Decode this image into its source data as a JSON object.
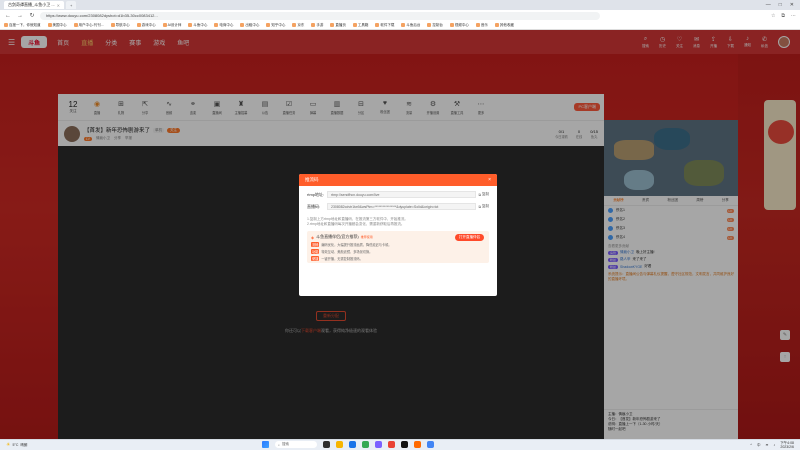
{
  "browser": {
    "tabs": [
      {
        "label": "古剑奇谭直播_斗鱼小卫 ...",
        "active": true
      },
      {
        "label": "+",
        "active": false
      }
    ],
    "url": "https://www.douyu.com/2308082dyshot=d1b35-30cc0083412...",
    "bookmarks": [
      "百度一下，你就知道",
      "美国中心",
      "用户中心-刊刊...",
      "导航中心",
      "游戏中心",
      "AI设计师",
      "斗鱼中心",
      "电商中心",
      "出租中心",
      "知乎中心",
      "京东",
      "手游",
      "直播页",
      "工具箱",
      "软件下载",
      "斗鱼后台",
      "控制台",
      "视频中心",
      "音乐",
      "其他收藏"
    ],
    "window_controls": [
      "—",
      "□",
      "✕"
    ]
  },
  "site": {
    "logo": "斗鱼",
    "nav": [
      "首页",
      "直播",
      "分类",
      "赛事",
      "游戏",
      "鱼吧"
    ],
    "nav_active_index": 1,
    "header_right": [
      {
        "icon": "search-icon",
        "label": "搜索"
      },
      {
        "icon": "history-icon",
        "label": "历史"
      },
      {
        "icon": "follow-icon",
        "label": "关注"
      },
      {
        "icon": "message-icon",
        "label": "消息"
      },
      {
        "icon": "upload-icon",
        "label": "开播"
      },
      {
        "icon": "download-icon",
        "label": "下载"
      },
      {
        "icon": "bell-icon",
        "label": "通知"
      },
      {
        "icon": "mail-icon",
        "label": "私信"
      }
    ]
  },
  "funcbar": {
    "count_value": "12",
    "count_label": "关注",
    "items": [
      "直播",
      "礼物",
      "分享",
      "音频",
      "连麦",
      "直播间",
      "主播招募",
      "公告",
      "直播任务",
      "弹幕",
      "直播数据",
      "分区",
      "粉丝团",
      "流量",
      "开播设置",
      "直播工具",
      "更多"
    ],
    "pc_button": "PC客户端"
  },
  "room": {
    "title": "【首发】新年恐怖剧游来了",
    "category_tag": "单机",
    "follow": "关注",
    "level": "LV",
    "streamer": "情痕小卫",
    "meta": [
      "分享",
      "举报"
    ],
    "stats": [
      {
        "value": "0/1",
        "label": "今日观看"
      },
      {
        "value": "0",
        "label": "在线"
      },
      {
        "value": "0/15",
        "label": "鱼丸"
      }
    ]
  },
  "video": {
    "closed_button": "重新分配",
    "note_prefix": "你还可以",
    "note_link": "下载客户端",
    "note_suffix": "观看，获得纯净极速的观看体验"
  },
  "modal": {
    "title": "推流码",
    "close": "×",
    "rows": [
      {
        "label": "rtmp地址:",
        "value": "rtmp://sendfhcn.douyu.com/live",
        "copy": "复制"
      },
      {
        "label": "直播码:",
        "value": "2308082cdvtr1tw9&wsPtm=****************&dyuplate=Solid&origin=tct",
        "copy": "复制"
      }
    ],
    "tips": [
      "1.复制上方rtmp地址和直播码，在推流第三方软件中，开始推流。",
      "2.rtmp地址和直播码每次开播都会变化，需重新获取后再推流。"
    ],
    "promo": {
      "title": "斗鱼直播伴侣(官方推荐)",
      "subtitle": "推荐使用",
      "button": "打开直播伴侣",
      "lines": [
        {
          "key": "流畅",
          "text": "编码优化，大幅提升推流画质，降低延迟与卡顿。"
        },
        {
          "key": "功能",
          "text": "特效互动、美颜滤镜、多场景切换。"
        },
        {
          "key": "便捷",
          "text": "一键开播，无需复制推流码。"
        }
      ]
    }
  },
  "chat": {
    "tabs": [
      "贡献榜",
      "贵宾",
      "粉丝团",
      "周榜",
      "分享"
    ],
    "active_tab_index": 0,
    "ranks": [
      {
        "name": "佚名1",
        "pill": "LV"
      },
      {
        "name": "佚名2",
        "pill": "LV"
      },
      {
        "name": "佚名3",
        "pill": "LV"
      },
      {
        "name": "佚名4",
        "pill": "LV"
      }
    ],
    "notice": "查看更多贡献",
    "lines": [
      {
        "badge": "房管",
        "name": "情痕小卫",
        "text": "晚上好主播!"
      },
      {
        "badge": "粉丝",
        "name": "路人甲",
        "text": "来了来了"
      },
      {
        "badge": "粉丝",
        "name": "ShadowKYGE",
        "text": "好看"
      }
    ],
    "system_text": "系统提示：直播间公告与弹幕礼仪提醒，遵守社区规范，文明发言，共同维护良好的直播环境。",
    "bottom_lines": [
      "主播：情痕小卫",
      "今日：【首发】新年恐怖剧游来了",
      "说明：直播上一下（1-30 小时/天）",
      "随时一起吧"
    ]
  },
  "taskbar": {
    "weather_temp": "5°C",
    "weather_desc": "晴朗",
    "search_label": "搜索",
    "time": "下午4:08",
    "date": "2023/2/6",
    "lang": "中"
  }
}
